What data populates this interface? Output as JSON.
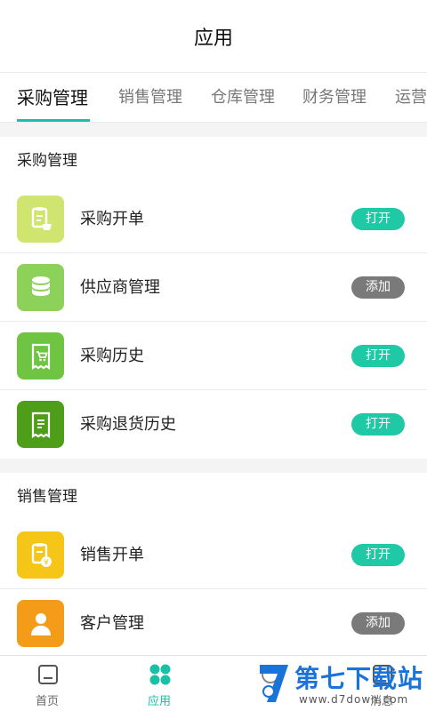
{
  "header": {
    "title": "应用"
  },
  "tabs": [
    {
      "label": "采购管理"
    },
    {
      "label": "销售管理"
    },
    {
      "label": "仓库管理"
    },
    {
      "label": "财务管理"
    },
    {
      "label": "运营"
    }
  ],
  "sections": [
    {
      "title": "采购管理",
      "items": [
        {
          "label": "采购开单",
          "button": "打开",
          "icon": "purchase-order-icon",
          "color": "#cfe56f"
        },
        {
          "label": "供应商管理",
          "button": "添加",
          "icon": "supplier-database-icon",
          "color": "#8cd25a"
        },
        {
          "label": "采购历史",
          "button": "打开",
          "icon": "cart-receipt-icon",
          "color": "#6fc541"
        },
        {
          "label": "采购退货历史",
          "button": "打开",
          "icon": "return-receipt-icon",
          "color": "#4f9e1a"
        }
      ]
    },
    {
      "title": "销售管理",
      "items": [
        {
          "label": "销售开单",
          "button": "打开",
          "icon": "sales-order-icon",
          "color": "#f5c518"
        },
        {
          "label": "客户管理",
          "button": "添加",
          "icon": "customer-icon",
          "color": "#f59b1a"
        }
      ]
    }
  ],
  "bottom_nav": [
    {
      "label": "首页",
      "icon": "home-icon"
    },
    {
      "label": "应用",
      "icon": "apps-icon",
      "active": true
    },
    {
      "label": "",
      "icon": "nav-icon-3"
    },
    {
      "label": "消息",
      "icon": "message-icon"
    }
  ],
  "watermark": {
    "title": "第七下载站",
    "url": "www.d7down.com"
  },
  "colors": {
    "accent": "#19c0a6",
    "open_button": "#1fc9a5",
    "add_button": "#7a7a7a",
    "watermark": "#1a73d9"
  }
}
